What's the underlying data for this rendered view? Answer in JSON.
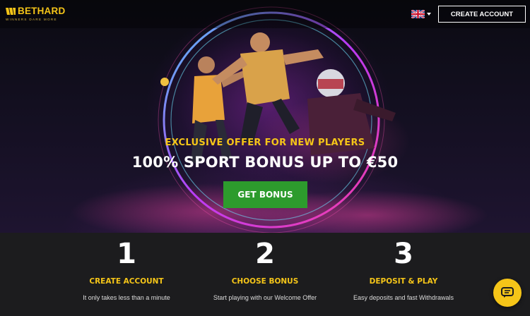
{
  "brand": {
    "name": "BETHARD",
    "tagline": "WINNERS DARE MORE",
    "logo_icon": "bethard-logo-icon",
    "accent_color": "#f5c518"
  },
  "header": {
    "language_icon": "uk-flag-icon",
    "create_account_label": "CREATE ACCOUNT"
  },
  "hero": {
    "offer_label": "EXCLUSIVE OFFER FOR NEW PLAYERS",
    "headline": "100% SPORT BONUS UP TO €50",
    "cta_label": "GET BONUS",
    "cta_color": "#2d9b2d"
  },
  "steps": [
    {
      "number": "1",
      "title": "CREATE ACCOUNT",
      "description": "It only takes less than a minute"
    },
    {
      "number": "2",
      "title": "CHOOSE BONUS",
      "description": "Start playing with our Welcome Offer"
    },
    {
      "number": "3",
      "title": "DEPOSIT & PLAY",
      "description": "Easy deposits and fast Withdrawals"
    }
  ],
  "chat": {
    "icon": "chat-icon"
  }
}
